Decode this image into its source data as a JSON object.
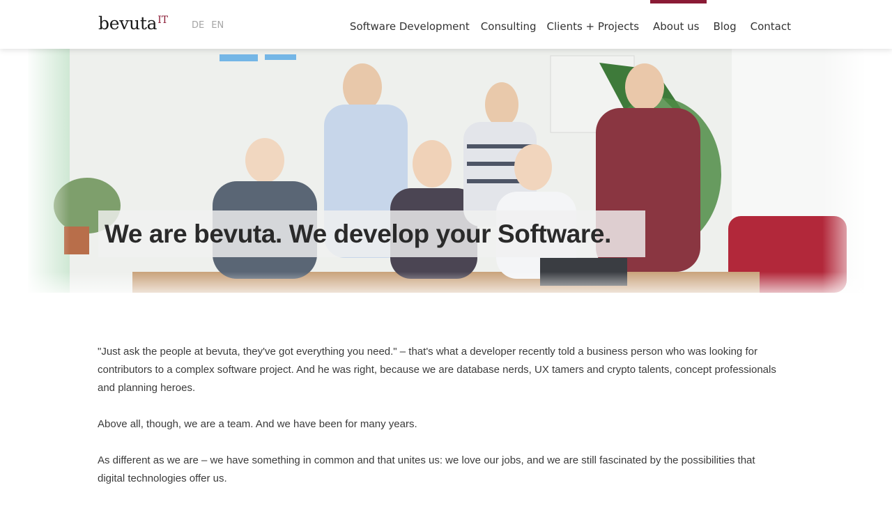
{
  "header": {
    "logo": {
      "main": "bevuta",
      "sup": "IT"
    },
    "languages": [
      "DE",
      "EN"
    ],
    "nav": {
      "software_development": "Software Development",
      "consulting": "Consulting",
      "clients_projects": "Clients + Projects",
      "about_us": "About us",
      "blog": "Blog",
      "contact": "Contact"
    },
    "active_indicator_color": "#8a1b35"
  },
  "hero": {
    "headline": "We are bevuta. We develop your Software.",
    "image": "team-photo"
  },
  "content": {
    "paragraphs": [
      "\"Just ask the people at bevuta, they've got everything you need.\" – that's what a developer recently told a business person who was looking for contributors to a complex software project. And he was right, because we are database nerds, UX tamers and crypto talents, concept professionals and planning heroes.",
      "Above all, though, we are a team. And we have been for many years.",
      "As different as we are – we have something in common and that unites us: we love our jobs, and we are still fascinated by the possibilities that digital technologies offer us."
    ]
  },
  "colors": {
    "brand": "#8a1b35",
    "text": "#333333"
  }
}
